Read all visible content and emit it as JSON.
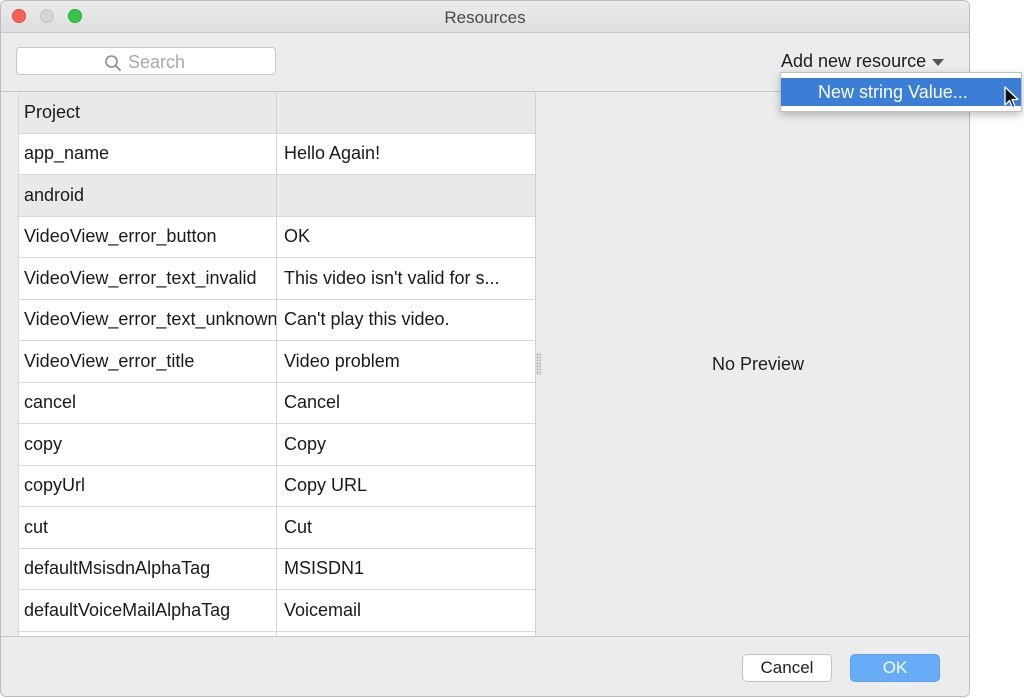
{
  "window": {
    "title": "Resources"
  },
  "search": {
    "placeholder": "Search"
  },
  "toolbar": {
    "add_resource_label": "Add new resource"
  },
  "dropdown": {
    "items": [
      {
        "label": "New string Value..."
      }
    ]
  },
  "table": {
    "rows": [
      {
        "type": "group",
        "name": "Project",
        "value": ""
      },
      {
        "type": "item",
        "name": "app_name",
        "value": "Hello Again!"
      },
      {
        "type": "group",
        "name": "android",
        "value": ""
      },
      {
        "type": "item",
        "name": "VideoView_error_button",
        "value": "OK"
      },
      {
        "type": "item",
        "name": "VideoView_error_text_invalid",
        "value": "This video isn't valid for s..."
      },
      {
        "type": "item",
        "name": "VideoView_error_text_unknown",
        "value": "Can't play this video."
      },
      {
        "type": "item",
        "name": "VideoView_error_title",
        "value": "Video problem"
      },
      {
        "type": "item",
        "name": "cancel",
        "value": "Cancel"
      },
      {
        "type": "item",
        "name": "copy",
        "value": "Copy"
      },
      {
        "type": "item",
        "name": "copyUrl",
        "value": "Copy URL"
      },
      {
        "type": "item",
        "name": "cut",
        "value": "Cut"
      },
      {
        "type": "item",
        "name": "defaultMsisdnAlphaTag",
        "value": "MSISDN1"
      },
      {
        "type": "item",
        "name": "defaultVoiceMailAlphaTag",
        "value": "Voicemail"
      },
      {
        "type": "item",
        "name": "",
        "value": ""
      }
    ]
  },
  "preview": {
    "text": "No Preview"
  },
  "buttons": {
    "cancel_label": "Cancel",
    "ok_label": "OK"
  },
  "icons": {
    "search": "magnifier-icon",
    "dropdown": "caret-down-icon",
    "cursor": "arrow-cursor-icon"
  },
  "colors": {
    "accent": "#3b7ed8",
    "ok_button": "#67acf7",
    "close": "#fc605b",
    "maximize": "#34c748"
  }
}
